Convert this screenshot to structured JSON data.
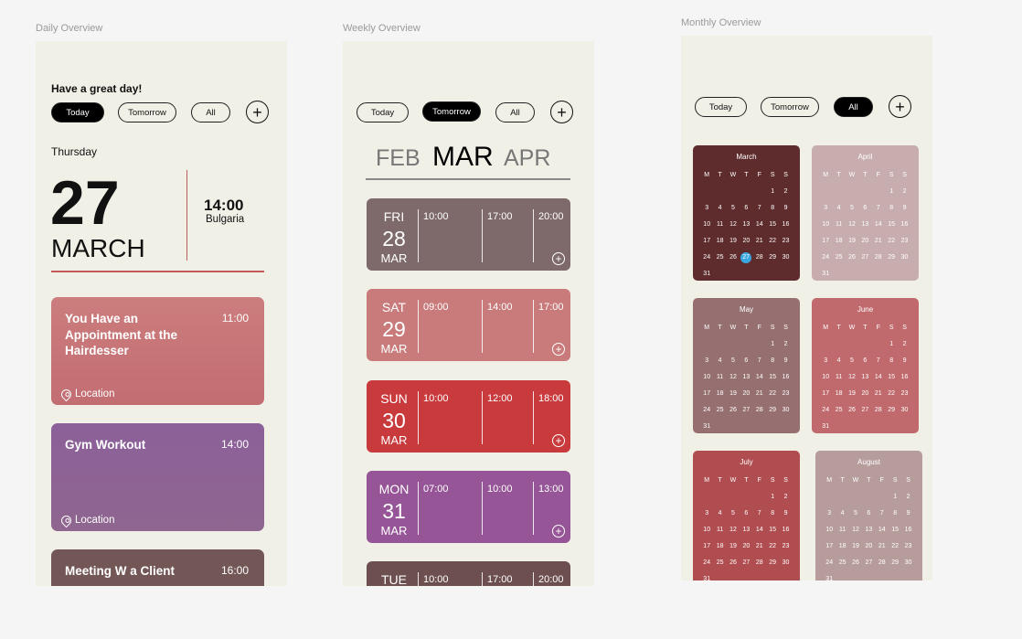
{
  "labels": {
    "daily": "Daily Overview",
    "weekly": "Weekly Overview",
    "monthly": "Monthly Overview"
  },
  "filters": {
    "today": "Today",
    "tomorrow": "Tomorrow",
    "all": "All",
    "add": "+"
  },
  "daily": {
    "greeting": "Have a great day!",
    "weekday": "Thursday",
    "day": "27",
    "month": "MARCH",
    "time": "14:00",
    "place": "Bulgaria",
    "events": [
      {
        "title": "You Have an Appointment at the Hairdesser",
        "time": "11:00",
        "location": "Location"
      },
      {
        "title": "Gym Workout",
        "time": "14:00",
        "location": "Location"
      },
      {
        "title": "Meeting W a Client",
        "time": "16:00"
      }
    ]
  },
  "weekly": {
    "months": {
      "prev": "FEB",
      "current": "MAR",
      "next": "APR"
    },
    "days": [
      {
        "dow": "FRI",
        "day": "28",
        "mon": "MAR",
        "slots": [
          "10:00",
          "17:00",
          "20:00"
        ],
        "color": "#7e6a6a"
      },
      {
        "dow": "SAT",
        "day": "29",
        "mon": "MAR",
        "slots": [
          "09:00",
          "14:00",
          "17:00"
        ],
        "color": "#c97b7b"
      },
      {
        "dow": "SUN",
        "day": "30",
        "mon": "MAR",
        "slots": [
          "10:00",
          "12:00",
          "18:00"
        ],
        "color": "#c93a3d"
      },
      {
        "dow": "MON",
        "day": "31",
        "mon": "MAR",
        "slots": [
          "07:00",
          "10:00",
          "13:00"
        ],
        "color": "#965596"
      },
      {
        "dow": "TUE",
        "day": "",
        "mon": "",
        "slots": [
          "10:00",
          "17:00",
          "20:00"
        ],
        "color": "#6e4f4f"
      }
    ]
  },
  "monthly": {
    "weekday_headers": [
      "M",
      "T",
      "W",
      "T",
      "F",
      "S",
      "S"
    ],
    "months": [
      {
        "name": "March",
        "color": "#5e2c2c",
        "highlight": "27"
      },
      {
        "name": "April",
        "color": "#c7adad",
        "highlight": ""
      },
      {
        "name": "May",
        "color": "#967070",
        "highlight": ""
      },
      {
        "name": "June",
        "color": "#c06a6d",
        "highlight": ""
      },
      {
        "name": "July",
        "color": "#b04d50",
        "highlight": ""
      },
      {
        "name": "August",
        "color": "#b79c9c",
        "highlight": ""
      }
    ],
    "weeks": [
      [
        "",
        "",
        "",
        "",
        "",
        "1",
        "2"
      ],
      [
        "3",
        "4",
        "5",
        "6",
        "7",
        "8",
        "9"
      ],
      [
        "10",
        "11",
        "12",
        "13",
        "14",
        "15",
        "16"
      ],
      [
        "17",
        "18",
        "19",
        "20",
        "21",
        "22",
        "23"
      ],
      [
        "24",
        "25",
        "26",
        "27",
        "28",
        "29",
        "30"
      ],
      [
        "31",
        "",
        "",
        "",
        "",
        "",
        ""
      ]
    ]
  }
}
